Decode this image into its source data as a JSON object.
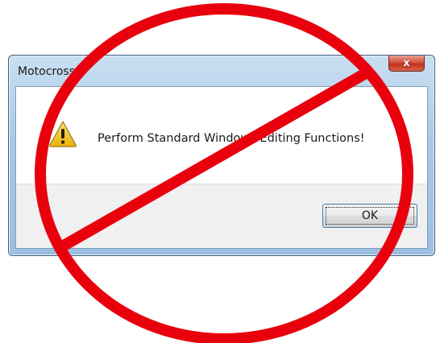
{
  "dialog": {
    "title": "Motocross",
    "close_label": "x",
    "message": "Perform Standard Windows Editing Functions!",
    "ok_label": "OK"
  },
  "icons": {
    "warning": "warning-triangle-icon",
    "overlay": "prohibition-sign-icon"
  },
  "colors": {
    "prohibition_red": "#e8000d",
    "warning_yellow": "#f3c316",
    "title_bar_blue": "#a9c8e6",
    "close_button_red": "#c0301c"
  }
}
